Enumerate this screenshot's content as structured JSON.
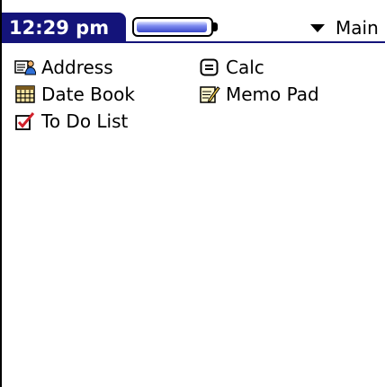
{
  "status_bar": {
    "time": "12:29 pm",
    "battery_level": 1.0,
    "category": "Main"
  },
  "apps": [
    {
      "label": "Address",
      "icon": "address-book-icon"
    },
    {
      "label": "Calc",
      "icon": "calculator-icon"
    },
    {
      "label": "Date Book",
      "icon": "calendar-icon"
    },
    {
      "label": "Memo Pad",
      "icon": "memo-pad-icon"
    },
    {
      "label": "To Do List",
      "icon": "todo-checkbox-icon"
    }
  ],
  "colors": {
    "title_bar": "#14147a",
    "battery_fill": "#3a48c8"
  }
}
